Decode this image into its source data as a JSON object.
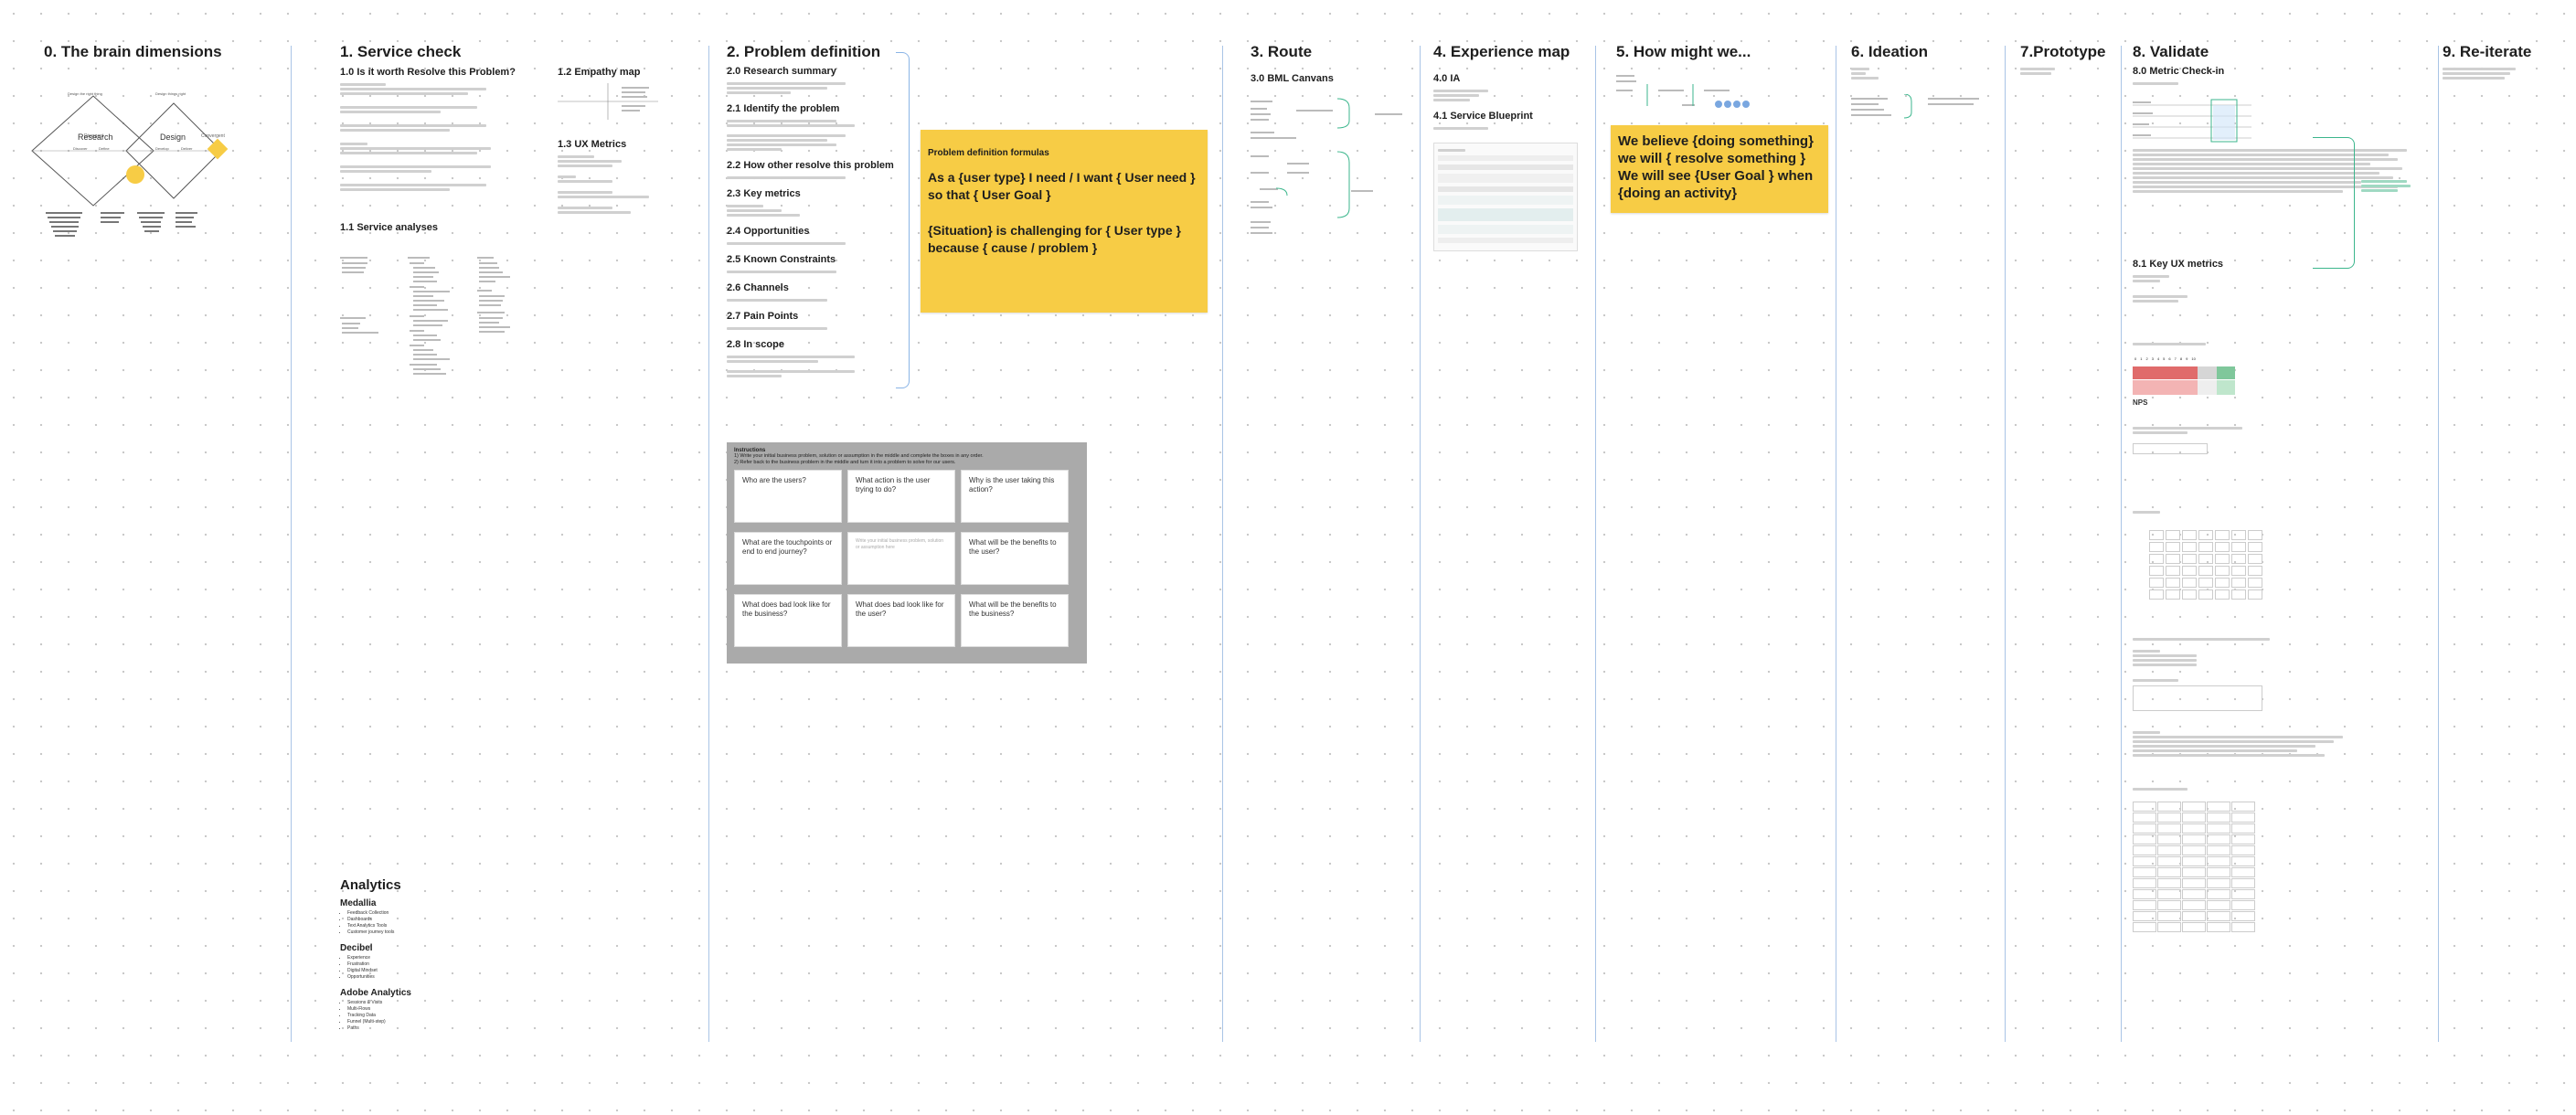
{
  "sections": [
    {
      "id": "s0",
      "title": "0. The brain dimensions"
    },
    {
      "id": "s1",
      "title": "1.  Service check"
    },
    {
      "id": "s2",
      "title": "2. Problem definition"
    },
    {
      "id": "s3",
      "title": "3. Route"
    },
    {
      "id": "s4",
      "title": "4. Experience map"
    },
    {
      "id": "s5",
      "title": "5. How might we..."
    },
    {
      "id": "s6",
      "title": "6. Ideation"
    },
    {
      "id": "s7",
      "title": "7.Prototype"
    },
    {
      "id": "s8",
      "title": "8. Validate"
    },
    {
      "id": "s9",
      "title": "9. Re-iterate"
    }
  ],
  "brain": {
    "left_diamond": "Research",
    "right_diamond": "Design",
    "left_top": "Design the right thing",
    "right_top": "Design things right",
    "labels": [
      "Discover",
      "Define",
      "Develop",
      "Deliver"
    ]
  },
  "service_check": {
    "h1_0": "1.0 Is it worth Resolve this Problem?",
    "h1_2": "1.2 Empathy map",
    "h1_3": "1.3 UX Metrics",
    "h1_1": "1.1 Service analyses"
  },
  "analytics": {
    "title": "Analytics",
    "tools": [
      {
        "name": "Medallia",
        "items": [
          "Feedback Collection",
          "Dashboards",
          "Text Analytics Tools",
          "Customer journey tools"
        ]
      },
      {
        "name": "Decibel",
        "items": [
          "Experience",
          "Frustration",
          "Digital Mindset",
          "Opportunities"
        ]
      },
      {
        "name": "Adobe Analytics",
        "items": [
          "Sessions & Visits",
          "Multi-Flows",
          "Tracking Data",
          "Funnel (Multi-step)",
          "Paths"
        ]
      }
    ]
  },
  "problem": {
    "headings": [
      "2.0 Research summary",
      "2.1 Identify the problem",
      "2.2 How other resolve this problem",
      "2.3 Key metrics",
      "2.4 Opportunities",
      "2.5 Known Constraints",
      "2.6 Channels",
      "2.7 Pain Points",
      "2.8 In scope"
    ],
    "formula_title": "Problem definition formulas",
    "formula_1": "As a {user type} I need / I want { User need } so that { User Goal }",
    "formula_2": "{Situation} is challenging for { User type } because { cause / problem }",
    "instructions_title": "Instructions",
    "instructions_1": "1) Write your initial business problem, solution or assumption in the middle and complete the boxes in any order.",
    "instructions_2": "2) Refer back to the business problem in the middle and turn it into a problem to solve for our users.",
    "cards": [
      "Who are the users?",
      "What action is the user trying to do?",
      "Why is the user taking this action?",
      "What are the touchpoints or end to end journey?",
      "Write your initial business problem, solution or assumption here",
      "What will be the benefits to the user?",
      "What does bad look like for the business?",
      "What does bad look like for the user?",
      "What will be the benefits to the business?"
    ]
  },
  "route": {
    "h": "3.0 BML Canvans"
  },
  "experience": {
    "h1": "4.0 IA",
    "h2": "4.1 Service Blueprint"
  },
  "hmw": {
    "statement": "We believe {doing something} we will { resolve something } We will see {User Goal } when {doing an activity}"
  },
  "validate": {
    "h1": "8.0 Metric Check-in",
    "h2": "8.1 Key UX metrics",
    "nps_label": "NPS"
  }
}
